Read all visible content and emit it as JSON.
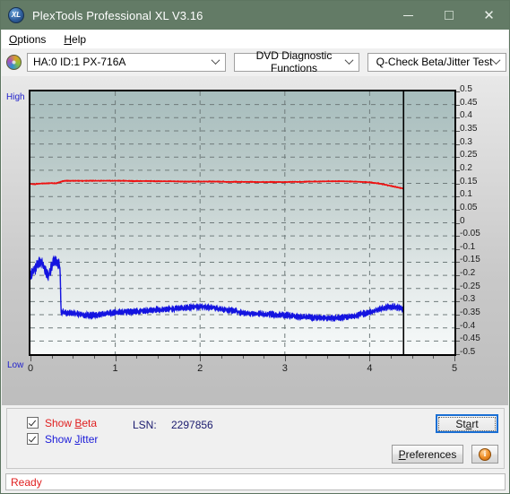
{
  "window": {
    "title": "PlexTools Professional XL V3.16",
    "icon": "plextools-xl-icon",
    "minimize_label": "",
    "maximize_label": "",
    "close_label": "✕"
  },
  "menu": {
    "items": [
      {
        "label": "Options",
        "accel": "O"
      },
      {
        "label": "Help",
        "accel": "H"
      }
    ]
  },
  "toolbar": {
    "drive_icon": "optical-disc-icon",
    "drive_select": "HA:0 ID:1  PX-716A",
    "function_select": "DVD Diagnostic Functions",
    "test_select": "Q-Check Beta/Jitter Test"
  },
  "chart_panel": {
    "axis_high_label": "High",
    "axis_low_label": "Low"
  },
  "controls": {
    "show_beta": {
      "label_pre": "Show ",
      "label_accel": "B",
      "label_post": "eta",
      "checked": true,
      "color": "#e02020"
    },
    "show_jitter": {
      "label_pre": "Show ",
      "label_accel": "J",
      "label_post": "itter",
      "checked": true,
      "color": "#1b1bd8"
    },
    "lsn_label": "LSN:",
    "lsn_value": "2297856",
    "start_button": {
      "pre": "St",
      "accel": "a",
      "post": "rt"
    },
    "preferences_button": {
      "pre": "",
      "accel": "P",
      "post": "references"
    },
    "info_button": "i"
  },
  "statusbar": {
    "text": "Ready"
  },
  "chart_data": {
    "type": "line",
    "title": "Q-Check Beta/Jitter Test",
    "xlabel": "",
    "ylabel": "",
    "xlim": [
      0,
      5
    ],
    "ylim": [
      -0.5,
      0.5
    ],
    "grid": true,
    "legend_position": "below-left",
    "xticks": [
      0,
      1,
      2,
      3,
      4,
      5
    ],
    "yticks": [
      0.5,
      0.45,
      0.4,
      0.35,
      0.3,
      0.25,
      0.2,
      0.15,
      0.1,
      0.05,
      0,
      -0.05,
      -0.1,
      -0.15,
      -0.2,
      -0.25,
      -0.3,
      -0.35,
      -0.4,
      -0.45,
      -0.5
    ],
    "ytick_labels": [
      "0.5",
      "0.45",
      "0.4",
      "0.35",
      "0.3",
      "0.25",
      "0.2",
      "0.15",
      "0.1",
      "0.05",
      "0",
      "-0.05",
      "-0.1",
      "-0.15",
      "-0.2",
      "-0.25",
      "-0.3",
      "-0.35",
      "-0.4",
      "-0.45",
      "-0.5"
    ],
    "xtick_labels": [
      "0",
      "1",
      "2",
      "3",
      "4",
      "5"
    ],
    "data_end_marker_x": 4.4,
    "series": [
      {
        "name": "Beta",
        "color": "#ee1111",
        "x": [
          0.0,
          0.05,
          0.1,
          0.15,
          0.2,
          0.25,
          0.3,
          0.35,
          0.4,
          0.5,
          0.6,
          0.7,
          0.8,
          0.9,
          1.0,
          1.1,
          1.2,
          1.3,
          1.4,
          1.5,
          1.6,
          1.7,
          1.8,
          1.9,
          2.0,
          2.1,
          2.2,
          2.3,
          2.4,
          2.5,
          2.6,
          2.7,
          2.8,
          2.9,
          3.0,
          3.1,
          3.2,
          3.3,
          3.4,
          3.5,
          3.6,
          3.7,
          3.8,
          3.9,
          4.0,
          4.1,
          4.2,
          4.3,
          4.4
        ],
        "values": [
          0.148,
          0.147,
          0.149,
          0.15,
          0.15,
          0.151,
          0.15,
          0.155,
          0.16,
          0.16,
          0.16,
          0.16,
          0.16,
          0.16,
          0.16,
          0.16,
          0.159,
          0.159,
          0.159,
          0.158,
          0.158,
          0.158,
          0.157,
          0.157,
          0.157,
          0.157,
          0.157,
          0.156,
          0.156,
          0.156,
          0.156,
          0.155,
          0.155,
          0.155,
          0.155,
          0.156,
          0.156,
          0.157,
          0.157,
          0.158,
          0.158,
          0.158,
          0.157,
          0.156,
          0.154,
          0.15,
          0.144,
          0.137,
          0.13
        ]
      },
      {
        "name": "Jitter",
        "color": "#1414e0",
        "x": [
          0.0,
          0.03,
          0.06,
          0.09,
          0.12,
          0.15,
          0.18,
          0.21,
          0.24,
          0.27,
          0.3,
          0.33,
          0.35,
          0.36,
          0.4,
          0.5,
          0.6,
          0.7,
          0.8,
          0.9,
          1.0,
          1.1,
          1.2,
          1.3,
          1.4,
          1.5,
          1.6,
          1.7,
          1.8,
          1.9,
          2.0,
          2.1,
          2.2,
          2.3,
          2.4,
          2.5,
          2.6,
          2.7,
          2.8,
          2.9,
          3.0,
          3.1,
          3.2,
          3.3,
          3.4,
          3.5,
          3.6,
          3.7,
          3.8,
          3.9,
          4.0,
          4.1,
          4.2,
          4.3,
          4.4
        ],
        "values": [
          -0.2,
          -0.185,
          -0.175,
          -0.15,
          -0.145,
          -0.16,
          -0.185,
          -0.205,
          -0.175,
          -0.15,
          -0.145,
          -0.155,
          -0.175,
          -0.34,
          -0.34,
          -0.345,
          -0.35,
          -0.352,
          -0.35,
          -0.345,
          -0.342,
          -0.34,
          -0.338,
          -0.336,
          -0.333,
          -0.331,
          -0.329,
          -0.327,
          -0.325,
          -0.322,
          -0.32,
          -0.322,
          -0.325,
          -0.33,
          -0.336,
          -0.342,
          -0.345,
          -0.346,
          -0.348,
          -0.35,
          -0.352,
          -0.355,
          -0.358,
          -0.36,
          -0.362,
          -0.363,
          -0.362,
          -0.36,
          -0.355,
          -0.348,
          -0.34,
          -0.33,
          -0.322,
          -0.318,
          -0.33
        ],
        "noise_band": 0.02
      }
    ]
  }
}
